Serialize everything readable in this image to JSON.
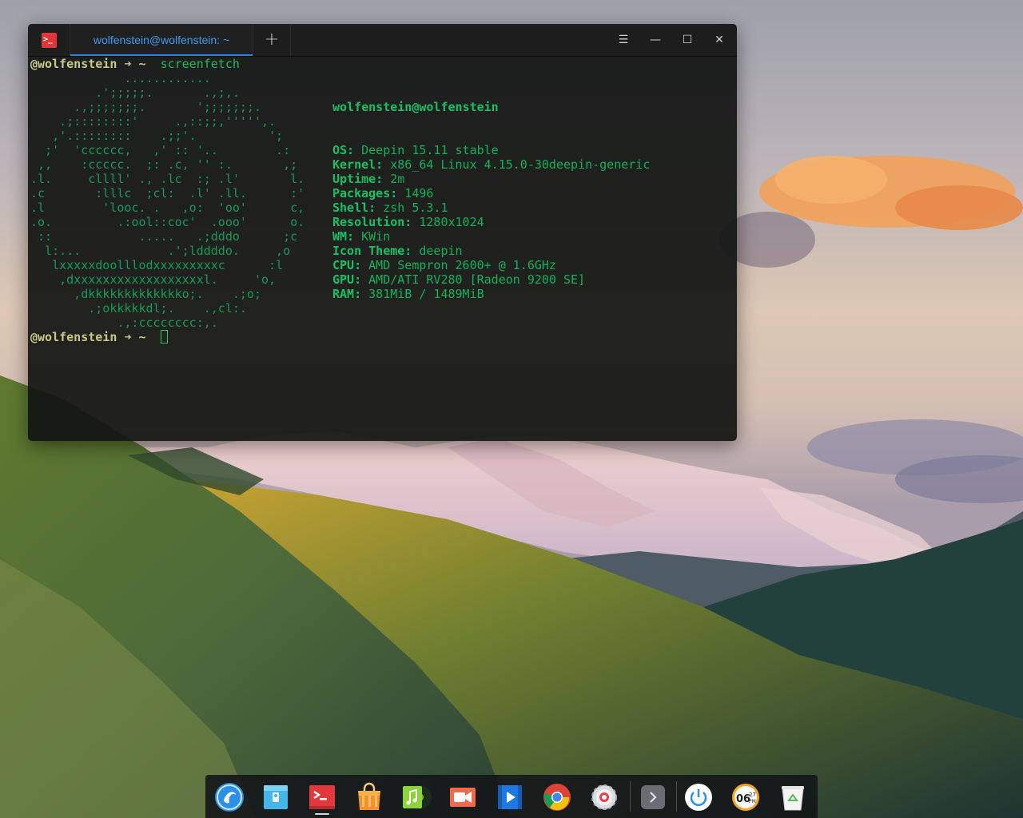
{
  "window": {
    "tab_title": "wolfenstein@wolfenstein: ~",
    "new_tab_glyph": "+",
    "menu_glyph": "☰",
    "minimize_glyph": "—",
    "maximize_glyph": "☐",
    "close_glyph": "✕",
    "app_icon_glyph": ">_"
  },
  "terminal": {
    "prompt1_user": "@wolfenstein",
    "prompt1_arrow": "➜",
    "prompt1_dir": "~",
    "prompt1_cmd": "screenfetch",
    "prompt2_user": "@wolfenstein",
    "prompt2_arrow": "➜",
    "prompt2_dir": "~",
    "ascii_art": [
      "             ............",
      "         .';;;;;.       .,;,.",
      "      .,;;;;;;;.       ';;;;;;;.",
      "    .;::::::::'     .,::;;,''''',.",
      "   ,'.::::::::    .;;'.          ';",
      "  ;'  'cccccc,   ,' :: '..        .:",
      " ,,    :ccccc.  ;: .c, '' :.       ,;",
      ".l.     cllll' ., .lc  :; .l'       l.",
      ".c       :lllc  ;cl:  .l' .ll.      :'",
      ".l        'looc. .   ,o:  'oo'      c,",
      ".o.         .:ool::coc'  .ooo'      o.",
      " ::            .....   .;dddo      ;c",
      "  l:...            .';lddddo.     ,o",
      "   lxxxxxdoolllodxxxxxxxxxc      :l",
      "    ,dxxxxxxxxxxxxxxxxxxl.     'o,",
      "      ,dkkkkkkkkkkkkko;.    .;o;",
      "        .;okkkkkdl;.    .,cl:.",
      "            .,:cccccccc:,."
    ],
    "info": {
      "userhost": "wolfenstein@wolfenstein",
      "rows": [
        {
          "key": "OS:",
          "value": "Deepin 15.11 stable"
        },
        {
          "key": "Kernel:",
          "value": "x86_64 Linux 4.15.0-30deepin-generic"
        },
        {
          "key": "Uptime:",
          "value": "2m"
        },
        {
          "key": "Packages:",
          "value": "1496"
        },
        {
          "key": "Shell:",
          "value": "zsh 5.3.1"
        },
        {
          "key": "Resolution:",
          "value": "1280x1024"
        },
        {
          "key": "WM:",
          "value": "KWin"
        },
        {
          "key": "Icon Theme:",
          "value": "deepin"
        },
        {
          "key": "CPU:",
          "value": "AMD Sempron 2600+ @ 1.6GHz"
        },
        {
          "key": "GPU:",
          "value": "AMD/ATI RV280 [Radeon 9200 SE]"
        },
        {
          "key": "RAM:",
          "value": "381MiB / 1489MiB"
        }
      ]
    }
  },
  "dock": {
    "items": [
      {
        "name": "launcher-icon"
      },
      {
        "name": "file-manager-icon"
      },
      {
        "name": "terminal-icon"
      },
      {
        "name": "app-store-icon"
      },
      {
        "name": "music-icon"
      },
      {
        "name": "screen-recorder-icon"
      },
      {
        "name": "video-player-icon"
      },
      {
        "name": "chrome-icon"
      },
      {
        "name": "settings-icon"
      },
      {
        "name": "show-more-icon"
      },
      {
        "name": "power-icon"
      },
      {
        "name": "clock-icon"
      },
      {
        "name": "trash-icon"
      }
    ],
    "clock_hour": "06",
    "clock_minute": "27",
    "clock_ampm": "PM",
    "more_glyph": "›"
  },
  "colors": {
    "accent": "#2c82e6",
    "terminal_green": "#18a858",
    "prompt_yellow": "#c8c88a"
  }
}
